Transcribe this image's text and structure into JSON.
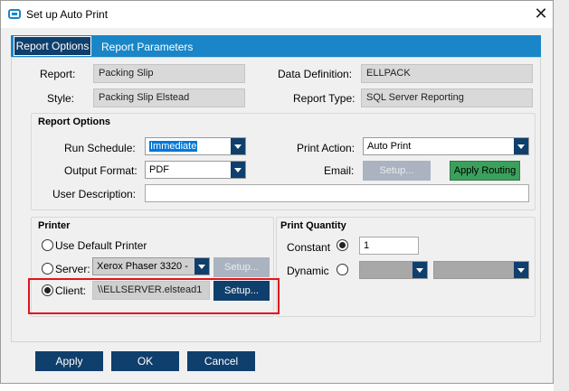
{
  "window": {
    "title": "Set up Auto Print",
    "close_glyph": "✕"
  },
  "tabs": [
    {
      "label": "Report Options",
      "active": true
    },
    {
      "label": "Report Parameters",
      "active": false
    }
  ],
  "header_fields": {
    "report_label": "Report:",
    "report_value": "Packing Slip",
    "style_label": "Style:",
    "style_value": "Packing Slip Elstead",
    "data_definition_label": "Data Definition:",
    "data_definition_value": "ELLPACK",
    "report_type_label": "Report Type:",
    "report_type_value": "SQL Server Reporting"
  },
  "report_options": {
    "title": "Report Options",
    "run_schedule_label": "Run Schedule:",
    "run_schedule_value": "Immediate",
    "output_format_label": "Output Format:",
    "output_format_value": "PDF",
    "user_description_label": "User Description:",
    "user_description_value": "",
    "print_action_label": "Print Action:",
    "print_action_value": "Auto Print",
    "email_label": "Email:",
    "email_setup_label": "Setup...",
    "apply_routing_label": "Apply Routing"
  },
  "printer": {
    "title": "Printer",
    "use_default_label": "Use Default Printer",
    "server_label": "Server:",
    "server_value": "Xerox Phaser 3320 -",
    "server_setup_label": "Setup...",
    "client_label": "Client:",
    "client_value": "\\\\ELLSERVER.elstead1",
    "client_setup_label": "Setup...",
    "selected": "client"
  },
  "print_quantity": {
    "title": "Print Quantity",
    "constant_label": "Constant",
    "constant_value": "1",
    "dynamic_label": "Dynamic",
    "selected": "constant"
  },
  "footer": {
    "apply_label": "Apply",
    "ok_label": "OK",
    "cancel_label": "Cancel"
  },
  "colors": {
    "accent": "#1a86c7",
    "dark_button": "#0f3f6c",
    "highlight_box": "#e0141c",
    "routing_button": "#3aa05c"
  }
}
